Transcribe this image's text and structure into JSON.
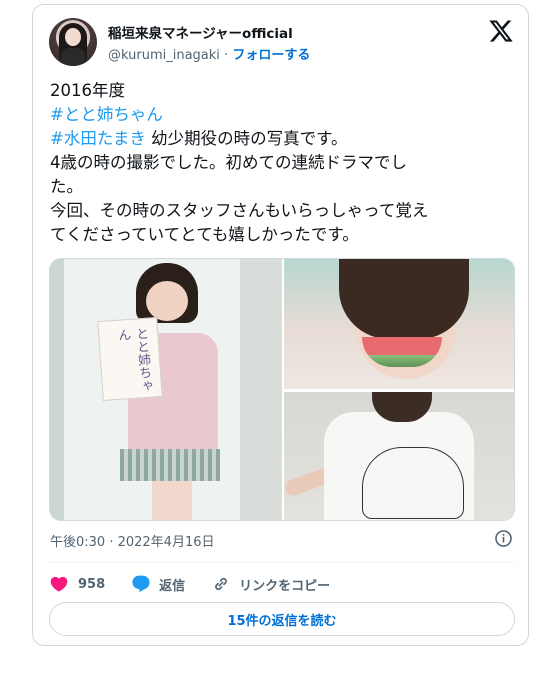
{
  "author": {
    "name": "稲垣来泉マネージャーofficial",
    "handle": "@kurumi_inagaki",
    "separator": " · ",
    "follow_label": "フォローする"
  },
  "platform_logo": "x-logo-icon",
  "tweet": {
    "line1": "2016年度",
    "hashtag1": "#とと姉ちゃん",
    "hashtag2": "#水田たまき",
    "line3_rest": " 幼少期役の時の写真です。",
    "line4": "4歳の時の撮影でした。初めての連続ドラマでし",
    "line5": "た。",
    "line6": "今回、その時のスタッフさんもいらっしゃって覚え",
    "line7": "てくださっていてとても嬉しかったです。"
  },
  "media": {
    "photo_count": 3,
    "book_title": "とと姉ちゃん"
  },
  "timestamp": "午後0:30 · 2022年4月16日",
  "actions": {
    "like_count": "958",
    "reply_label": "返信",
    "copy_link_label": "リンクをコピー"
  },
  "read_replies_label": "15件の返信を読む",
  "colors": {
    "link": "#1d9bf0",
    "follow": "#006fd6",
    "like": "#f91880",
    "reply": "#1d9bf0",
    "muted": "#536471",
    "border": "#cfd9de"
  }
}
